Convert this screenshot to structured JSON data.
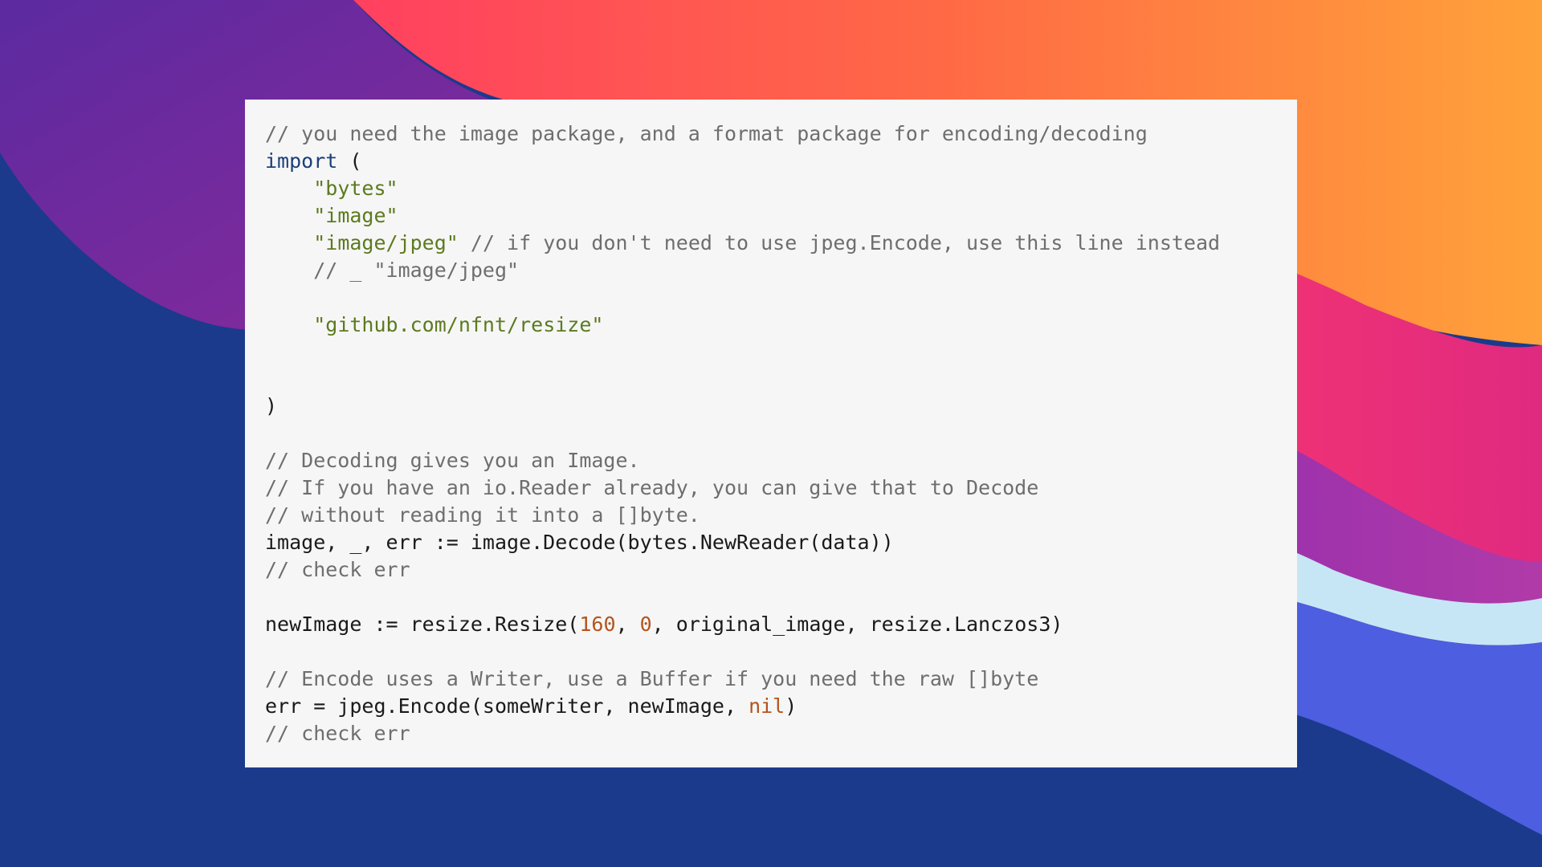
{
  "colors": {
    "card_background": "#f6f6f6",
    "comment": "#6e6e6e",
    "keyword": "#1c3f7a",
    "string": "#5c7a1f",
    "number": "#b4541c",
    "plain": "#1a1a1a"
  },
  "code_lines": [
    [
      {
        "type": "comment",
        "text": "// you need the image package, and a format package for encoding/decoding"
      }
    ],
    [
      {
        "type": "keyword",
        "text": "import"
      },
      {
        "type": "plain",
        "text": " ("
      }
    ],
    [
      {
        "type": "plain",
        "text": "    "
      },
      {
        "type": "string",
        "text": "\"bytes\""
      }
    ],
    [
      {
        "type": "plain",
        "text": "    "
      },
      {
        "type": "string",
        "text": "\"image\""
      }
    ],
    [
      {
        "type": "plain",
        "text": "    "
      },
      {
        "type": "string",
        "text": "\"image/jpeg\""
      },
      {
        "type": "comment",
        "text": " // if you don't need to use jpeg.Encode, use this line instead"
      }
    ],
    [
      {
        "type": "plain",
        "text": "    "
      },
      {
        "type": "comment",
        "text": "// _ \"image/jpeg\""
      }
    ],
    [],
    [
      {
        "type": "plain",
        "text": "    "
      },
      {
        "type": "string",
        "text": "\"github.com/nfnt/resize\""
      }
    ],
    [],
    [
      {
        "type": "plain",
        "text": ")"
      }
    ],
    [],
    [
      {
        "type": "comment",
        "text": "// Decoding gives you an Image."
      }
    ],
    [
      {
        "type": "comment",
        "text": "// If you have an io.Reader already, you can give that to Decode"
      }
    ],
    [
      {
        "type": "comment",
        "text": "// without reading it into a []byte."
      }
    ],
    [
      {
        "type": "plain",
        "text": "image, _, err := image.Decode(bytes.NewReader(data))"
      }
    ],
    [
      {
        "type": "comment",
        "text": "// check err"
      }
    ],
    [],
    [
      {
        "type": "plain",
        "text": "newImage := resize.Resize("
      },
      {
        "type": "number",
        "text": "160"
      },
      {
        "type": "plain",
        "text": ", "
      },
      {
        "type": "number",
        "text": "0"
      },
      {
        "type": "plain",
        "text": ", original_image, resize.Lanczos3)"
      }
    ],
    [],
    [
      {
        "type": "comment",
        "text": "// Encode uses a Writer, use a Buffer if you need the raw []byte"
      }
    ],
    [
      {
        "type": "plain",
        "text": "err = jpeg.Encode(someWriter, newImage, "
      },
      {
        "type": "number",
        "text": "nil"
      },
      {
        "type": "plain",
        "text": ")"
      }
    ],
    [
      {
        "type": "comment",
        "text": "// check err"
      }
    ]
  ]
}
